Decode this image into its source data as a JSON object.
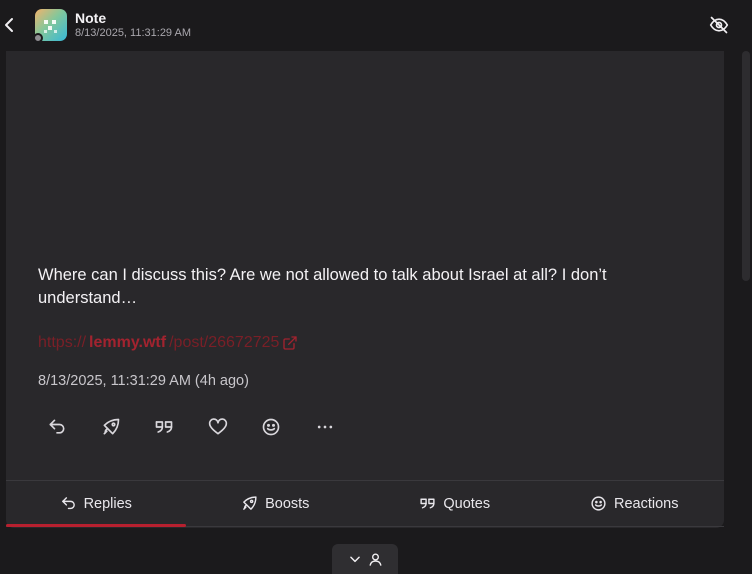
{
  "header": {
    "title": "Note",
    "subtitle": "8/13/2025, 11:31:29 AM",
    "back_icon": "chevron-left-icon",
    "hide_icon": "eye-off-icon"
  },
  "post": {
    "text": "Where can I discuss this? Are we not allowed to talk about Israel at all? I don’t understand…",
    "link": {
      "scheme": "https://",
      "host": "lemmy.wtf",
      "path": "/post/26672725",
      "icon": "external-link-icon"
    },
    "timestamp": "8/13/2025, 11:31:29 AM (4h ago)"
  },
  "actions": [
    {
      "name": "reply-icon"
    },
    {
      "name": "boost-icon"
    },
    {
      "name": "quote-icon"
    },
    {
      "name": "heart-icon"
    },
    {
      "name": "emoji-icon"
    },
    {
      "name": "more-icon"
    }
  ],
  "tabs": [
    {
      "label": "Replies",
      "icon": "reply-icon",
      "active": true
    },
    {
      "label": "Boosts",
      "icon": "rocket-icon",
      "active": false
    },
    {
      "label": "Quotes",
      "icon": "quote-icon",
      "active": false
    },
    {
      "label": "Reactions",
      "icon": "emoji-icon",
      "active": false
    }
  ],
  "colors": {
    "background": "#1b1a1c",
    "card": "#29282b",
    "accent": "#b7202f",
    "link": "#a2232f"
  }
}
